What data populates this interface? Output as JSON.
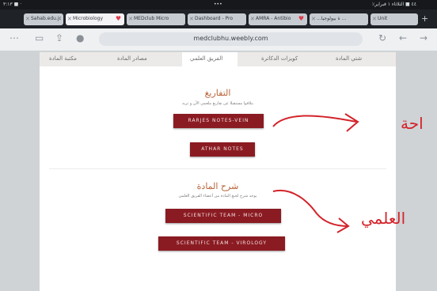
{
  "status_bar": {
    "left": "۳:۱۳ ■ ·",
    "center": "•••",
    "right": "٪٤٤ ■ الثلاثاء ۱ فبراير"
  },
  "tabs": [
    {
      "label": "Sahab.edu.jo"
    },
    {
      "label": "Microbiology"
    },
    {
      "label": "MEDclub Micro"
    },
    {
      "label": "Dashboard - Pro"
    },
    {
      "label": "AMRA - Antibio"
    },
    {
      "label": "...ة بيولوجيا ..."
    },
    {
      "label": "Unit"
    }
  ],
  "toolbar": {
    "url": "medclubhu.weebly.com"
  },
  "nav": {
    "items": [
      "شتي المادة",
      "كويزات الدكاترة",
      "الفريق العلمي",
      "مصادر المادة",
      "مكتبة المادة"
    ]
  },
  "sections": {
    "reports": {
      "title": "التفاريغ",
      "subtitle": "بتلاقوا مستقبلا عن تفاريغ ملعمي الأن و تريه",
      "buttons": [
        "RARJES NOTES-VEIN",
        "ATHAR NOTES"
      ]
    },
    "explain": {
      "title": "شرح المادة",
      "subtitle": "يوجد شرح لجيع المادة من أعضاء الفريق العلمي",
      "buttons": [
        "SCIENTIFIC TEAM - MICRO",
        "SCIENTIFIC TEAM - VIROLOGY"
      ]
    }
  },
  "annotations": {
    "top": "احة",
    "bottom": "العلمي"
  },
  "colors": {
    "button": "#8b1b22",
    "heading": "#b7643a",
    "annotation": "#d3232a"
  }
}
